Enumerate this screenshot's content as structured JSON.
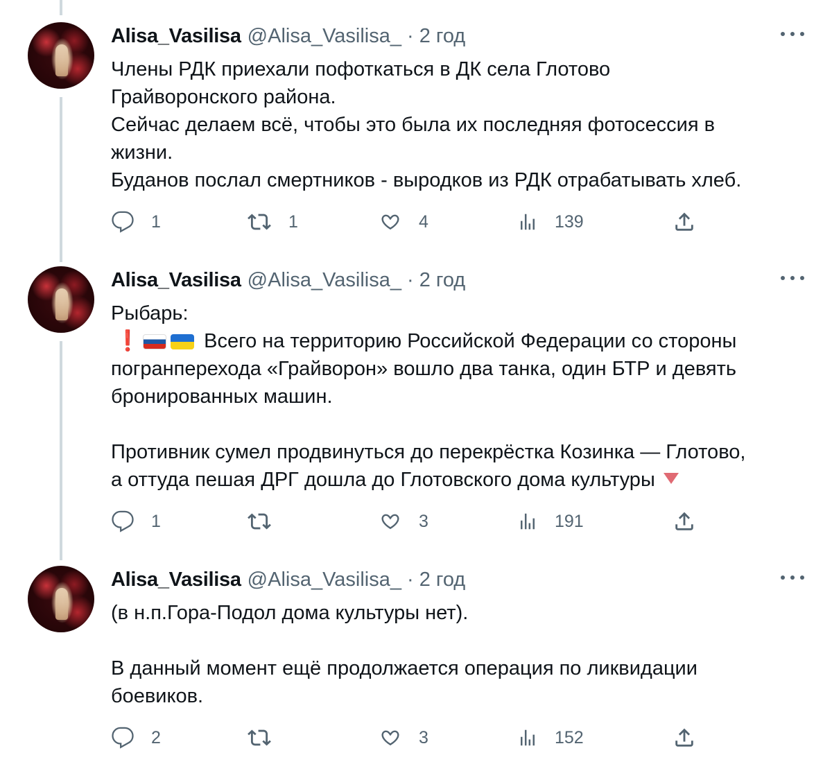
{
  "tweets": [
    {
      "name": "Alisa_Vasilisa",
      "handle": "@Alisa_Vasilisa_",
      "separator": "·",
      "time": "2 год",
      "text": "Члены РДК приехали пофоткаться в ДК села Глотово\nГрайворонского района.\nСейчас делаем всё, чтобы это была их последняя фотосессия в\nжизни.\nБуданов послал смертников - выродков из РДК отрабатывать хлеб.",
      "stats": {
        "replies": "1",
        "retweets": "1",
        "likes": "4",
        "views": "139"
      }
    },
    {
      "name": "Alisa_Vasilisa",
      "handle": "@Alisa_Vasilisa_",
      "separator": "·",
      "time": "2 год",
      "text_intro": "Рыбарь:",
      "emoji_prefix": "❗",
      "text_after_flags": "Всего на территорию Российской Федерации со стороны\nпогранперехода «Грайворон» вошло два танка, один БТР и девять\nбронированных машин.\n\nПротивник сумел продвинуться до перекрёстка Козинка — Глотово,\nа оттуда пешая ДРГ дошла до Глотовского дома культуры",
      "stats": {
        "replies": "1",
        "retweets": "",
        "likes": "3",
        "views": "191"
      }
    },
    {
      "name": "Alisa_Vasilisa",
      "handle": "@Alisa_Vasilisa_",
      "separator": "·",
      "time": "2 год",
      "text": "(в н.п.Гора-Подол дома культуры нет).\n\nВ данный момент ещё продолжается операция по ликвидации\nбоевиков.",
      "stats": {
        "replies": "2",
        "retweets": "",
        "likes": "3",
        "views": "152"
      }
    }
  ],
  "colors": {
    "text": "#0f1419",
    "secondary": "#536471",
    "thread_line": "#cfd9de",
    "warning_red": "#e0282e"
  },
  "icons": {
    "reply": "reply-icon",
    "retweet": "retweet-icon",
    "like": "heart-icon",
    "views": "views-chart-icon",
    "share": "share-icon",
    "more": "more-dots-icon"
  }
}
